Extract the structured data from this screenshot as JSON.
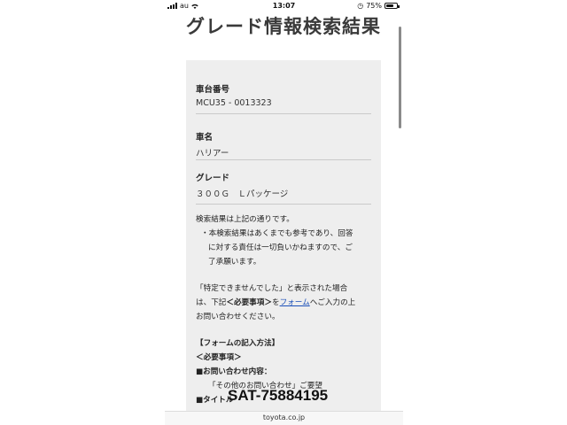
{
  "status_bar": {
    "carrier": "au",
    "time": "13:07",
    "battery": "75%",
    "battery_level": 0.75
  },
  "page": {
    "title": "グレード情報検索結果"
  },
  "result": {
    "fields": [
      {
        "label": "車台番号",
        "value": "MCU35 - 0013323"
      },
      {
        "label": "車名",
        "value": "ハリアー"
      },
      {
        "label": "グレード",
        "value": "３００Ｇ　Ｌパッケージ"
      }
    ]
  },
  "notes": {
    "line1": "検索結果は上記の通りです。",
    "bullet_a": "・本検索結果はあくまでも参考であり、回答",
    "bullet_b": "に対する責任は一切負いかねますので、ご",
    "bullet_c": "了承願います。",
    "para2_a": "「特定できませんでした」と表示された場合",
    "para2_b_1": "は、下記",
    "para2_b_bold": "＜必要事項＞",
    "para2_b_2": "を",
    "para2_b_link": "フォーム",
    "para2_b_3": "へご入力の上",
    "para2_c": "お問い合わせください。",
    "form_heading": "【フォームの記入方法】",
    "required_heading": "＜必要事項＞",
    "inquiry_label": "■お問い合わせ内容：",
    "inquiry_value": "「その他のお問い合わせ」ご要望",
    "title_label": "■タイトル"
  },
  "overlay": {
    "watermark": "SAT-75884195"
  },
  "url_bar": {
    "url": "toyota.co.jp"
  }
}
